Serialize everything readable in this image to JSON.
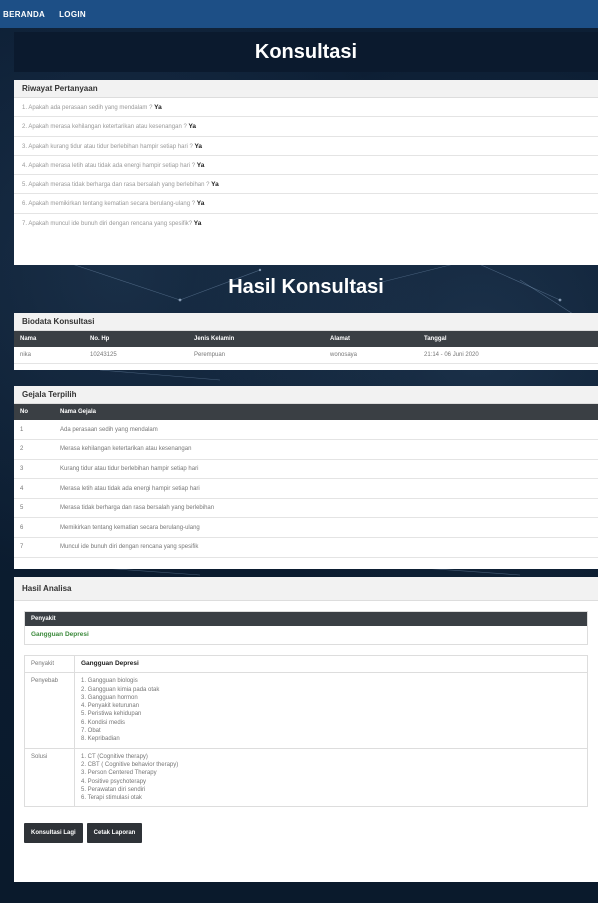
{
  "nav": {
    "beranda": "BERANDA",
    "login": "LOGIN"
  },
  "page_title": "Konsultasi",
  "riwayat": {
    "title": "Riwayat Pertanyaan",
    "items": [
      {
        "q": "1. Apakah ada perasaan sedih yang mendalam ?",
        "a": "Ya"
      },
      {
        "q": "2. Apakah merasa kehilangan ketertarikan atau kesenangan ?",
        "a": "Ya"
      },
      {
        "q": "3. Apakah kurang tidur atau tidur berlebihan hampir setiap hari ?",
        "a": "Ya"
      },
      {
        "q": "4. Apakah merasa letih atau tidak ada energi hampir setiap hari ?",
        "a": "Ya"
      },
      {
        "q": "5. Apakah merasa tidak berharga dan rasa bersalah yang berlebihan ?",
        "a": "Ya"
      },
      {
        "q": "6. Apakah memikirkan tentang kematian secara berulang-ulang ?",
        "a": "Ya"
      },
      {
        "q": "7. Apakah muncul ide bunuh diri dengan rencana yang spesifik?",
        "a": "Ya"
      }
    ]
  },
  "hasil_title": "Hasil Konsultasi",
  "biodata": {
    "title": "Biodata Konsultasi",
    "headers": [
      "Nama",
      "No. Hp",
      "Jenis Kelamin",
      "Alamat",
      "Tanggal"
    ],
    "row": [
      "nika",
      "10243125",
      "Perempuan",
      "wonosaya",
      "21:14 - 06 Juni 2020"
    ]
  },
  "gejala": {
    "title": "Gejala Terpilih",
    "headers": [
      "No",
      "Nama Gejala"
    ],
    "rows": [
      [
        "1",
        "Ada perasaan sedih yang mendalam"
      ],
      [
        "2",
        "Merasa kehilangan ketertarikan atau kesenangan"
      ],
      [
        "3",
        "Kurang tidur atau tidur berlebihan hampir setiap hari"
      ],
      [
        "4",
        "Merasa letih atau tidak ada energi hampir setiap hari"
      ],
      [
        "5",
        "Merasa tidak berharga dan rasa bersalah yang berlebihan"
      ],
      [
        "6",
        "Memikirkan tentang kematian secara berulang-ulang"
      ],
      [
        "7",
        "Muncul ide bunuh diri dengan rencana yang spesifik"
      ]
    ]
  },
  "analisa": {
    "title": "Hasil Analisa",
    "penyakit_header": "Penyakit",
    "penyakit_value": "Gangguan Depresi",
    "detail": {
      "penyakit_label": "Penyakit",
      "penyakit": "Gangguan Depresi",
      "penyebab_label": "Penyebab",
      "penyebab": [
        "1. Gangguan biologis",
        "2. Gangguan kimia pada otak",
        "3. Gangguan hormon",
        "4. Penyakit keturunan",
        "5. Peristiwa kehidupan",
        "6. Kondisi medis",
        "7. Obat",
        "8. Kepribadian"
      ],
      "solusi_label": "Solusi",
      "solusi": [
        "1. CT (Cognitive therapy)",
        "2. CBT ( Cognitive behavior therapy)",
        "3. Person Centered Therapy",
        "4. Positive psychoterapy",
        "5. Perawatan diri sendiri",
        "6. Terapi stimulasi otak"
      ]
    },
    "btn_konsultasi": "Konsultasi Lagi",
    "btn_cetak": "Cetak Laporan"
  },
  "colors": {
    "nav_bg": "#1d4f86",
    "header_dark": "#3a3f44",
    "penyakit_green": "#3c8a3c"
  }
}
